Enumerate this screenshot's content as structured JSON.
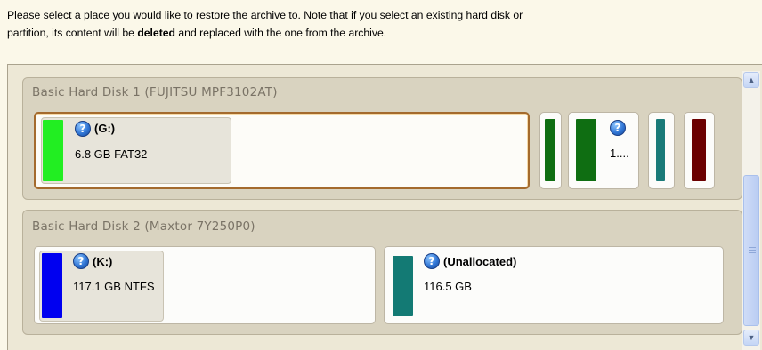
{
  "instruction": {
    "line1": "Please select a place you would like to restore the archive to. Note that if you select an existing hard disk or",
    "line2_prefix": "partition, its content will be ",
    "line2_bold": "deleted",
    "line2_suffix": " and replaced with the one from the archive."
  },
  "disks": [
    {
      "title": "Basic Hard Disk 1 (FUJITSU MPF3102AT)",
      "partitions": [
        {
          "name": "(G:)",
          "info": "6.8 GB FAT32",
          "color": "#22ee22",
          "selected": true
        },
        {
          "name": "",
          "info": "",
          "color": "#0f6e12"
        },
        {
          "name": "",
          "info": "1....",
          "color": "#0f6e12"
        },
        {
          "name": "",
          "info": "",
          "color": "#1a7a78"
        },
        {
          "name": "",
          "info": "",
          "color": "#6b0000"
        }
      ]
    },
    {
      "title": "Basic Hard Disk 2 (Maxtor 7Y250P0)",
      "partitions": [
        {
          "name": "(K:)",
          "info": "117.1 GB NTFS",
          "color": "#0000f0"
        },
        {
          "name": "(Unallocated)",
          "info": "116.5 GB",
          "color": "#137a74"
        }
      ]
    }
  ],
  "icons": {
    "help": "?"
  },
  "scrollbar": {
    "up": "▲",
    "down": "▼"
  }
}
